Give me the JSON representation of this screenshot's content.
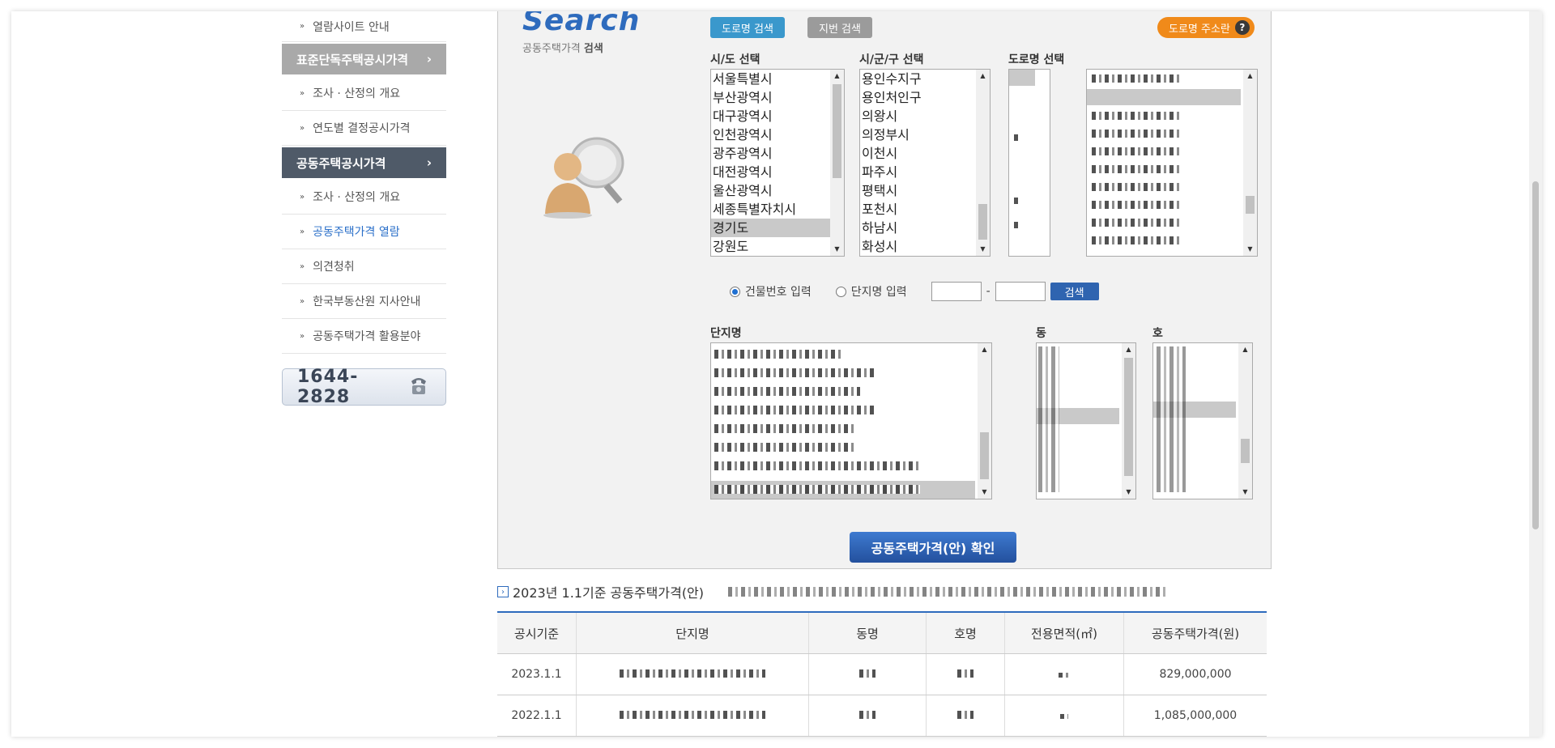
{
  "sidebar": {
    "top_item": "열람사이트 안내",
    "section1": {
      "label": "표준단독주택공시가격",
      "items": [
        "조사 · 산정의 개요",
        "연도별 결정공시가격"
      ]
    },
    "section2": {
      "label": "공동주택공시가격",
      "items": [
        "조사 · 산정의 개요",
        "공동주택가격 열람",
        "의견청취",
        "한국부동산원 지사안내",
        "공동주택가격 활용분야"
      ],
      "active_index": 1
    },
    "phone": "1644-2828"
  },
  "search": {
    "logo_word": "Search",
    "logo_sub_prefix": "공동주택가격",
    "logo_sub_bold": "검색",
    "tab_road": "도로명 검색",
    "tab_lot": "지번 검색",
    "road_addr_button": "도로명 주소란",
    "road_addr_help": "?",
    "sido_title": "시/도 선택",
    "sigungu_title": "시/군/구 선택",
    "road_title": "도로명 선택",
    "sido_options": [
      "서울특별시",
      "부산광역시",
      "대구광역시",
      "인천광역시",
      "광주광역시",
      "대전광역시",
      "울산광역시",
      "세종특별자치시",
      "경기도",
      "강원도"
    ],
    "sido_selected_index": 8,
    "sigungu_options": [
      "용인수지구",
      "용인처인구",
      "의왕시",
      "의정부시",
      "이천시",
      "파주시",
      "평택시",
      "포천시",
      "하남시",
      "화성시"
    ],
    "radio_building": "건물번호 입력",
    "radio_complex": "단지명 입력",
    "dash": "-",
    "search_button": "검색",
    "complex_title": "단지명",
    "dong_title": "동",
    "ho_title": "호",
    "confirm_button": "공동주택가격(안) 확인"
  },
  "result": {
    "title": "2023년 1.1기준 공동주택가격(안)",
    "columns": [
      "공시기준",
      "단지명",
      "동명",
      "호명",
      "전용면적(㎡)",
      "공동주택가격(원)"
    ],
    "rows": [
      {
        "base": "2023.1.1",
        "price": "829,000,000"
      },
      {
        "base": "2022.1.1",
        "price": "1,085,000,000"
      }
    ]
  }
}
